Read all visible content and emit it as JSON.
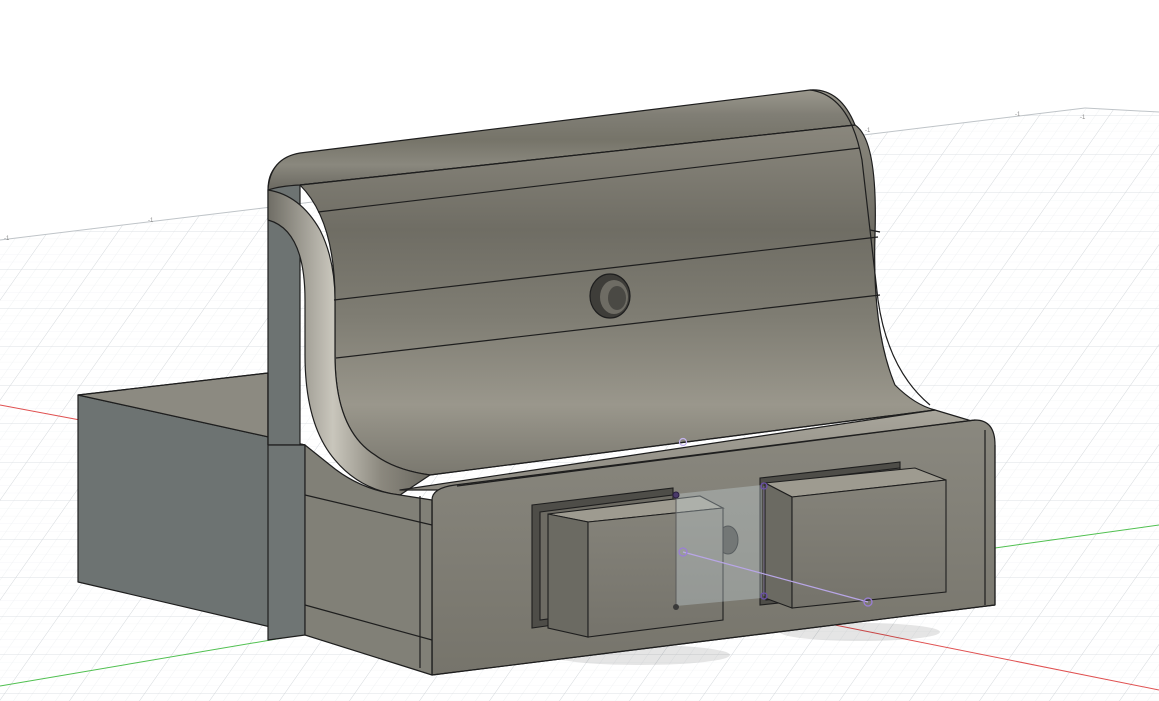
{
  "viewport": {
    "background": "#ffffff",
    "grid_minor_color": "#e9ecef",
    "grid_major_color": "#d2d6da",
    "axis_x_color": "#e05050",
    "axis_y_color": "#50c050",
    "ruler_labels": [
      "-1",
      "-1",
      "-1",
      "-1",
      "-1"
    ]
  },
  "model": {
    "body_color": "#7d7b72",
    "body_light": "#a8a59b",
    "body_dark": "#5b5a53",
    "side_color": "#6d7372",
    "edge_color": "#1e1e1e"
  },
  "sketch": {
    "point_color": "#9b7fd6",
    "line_color": "#b8a6e6",
    "selected_color": "#4a3a6a"
  }
}
